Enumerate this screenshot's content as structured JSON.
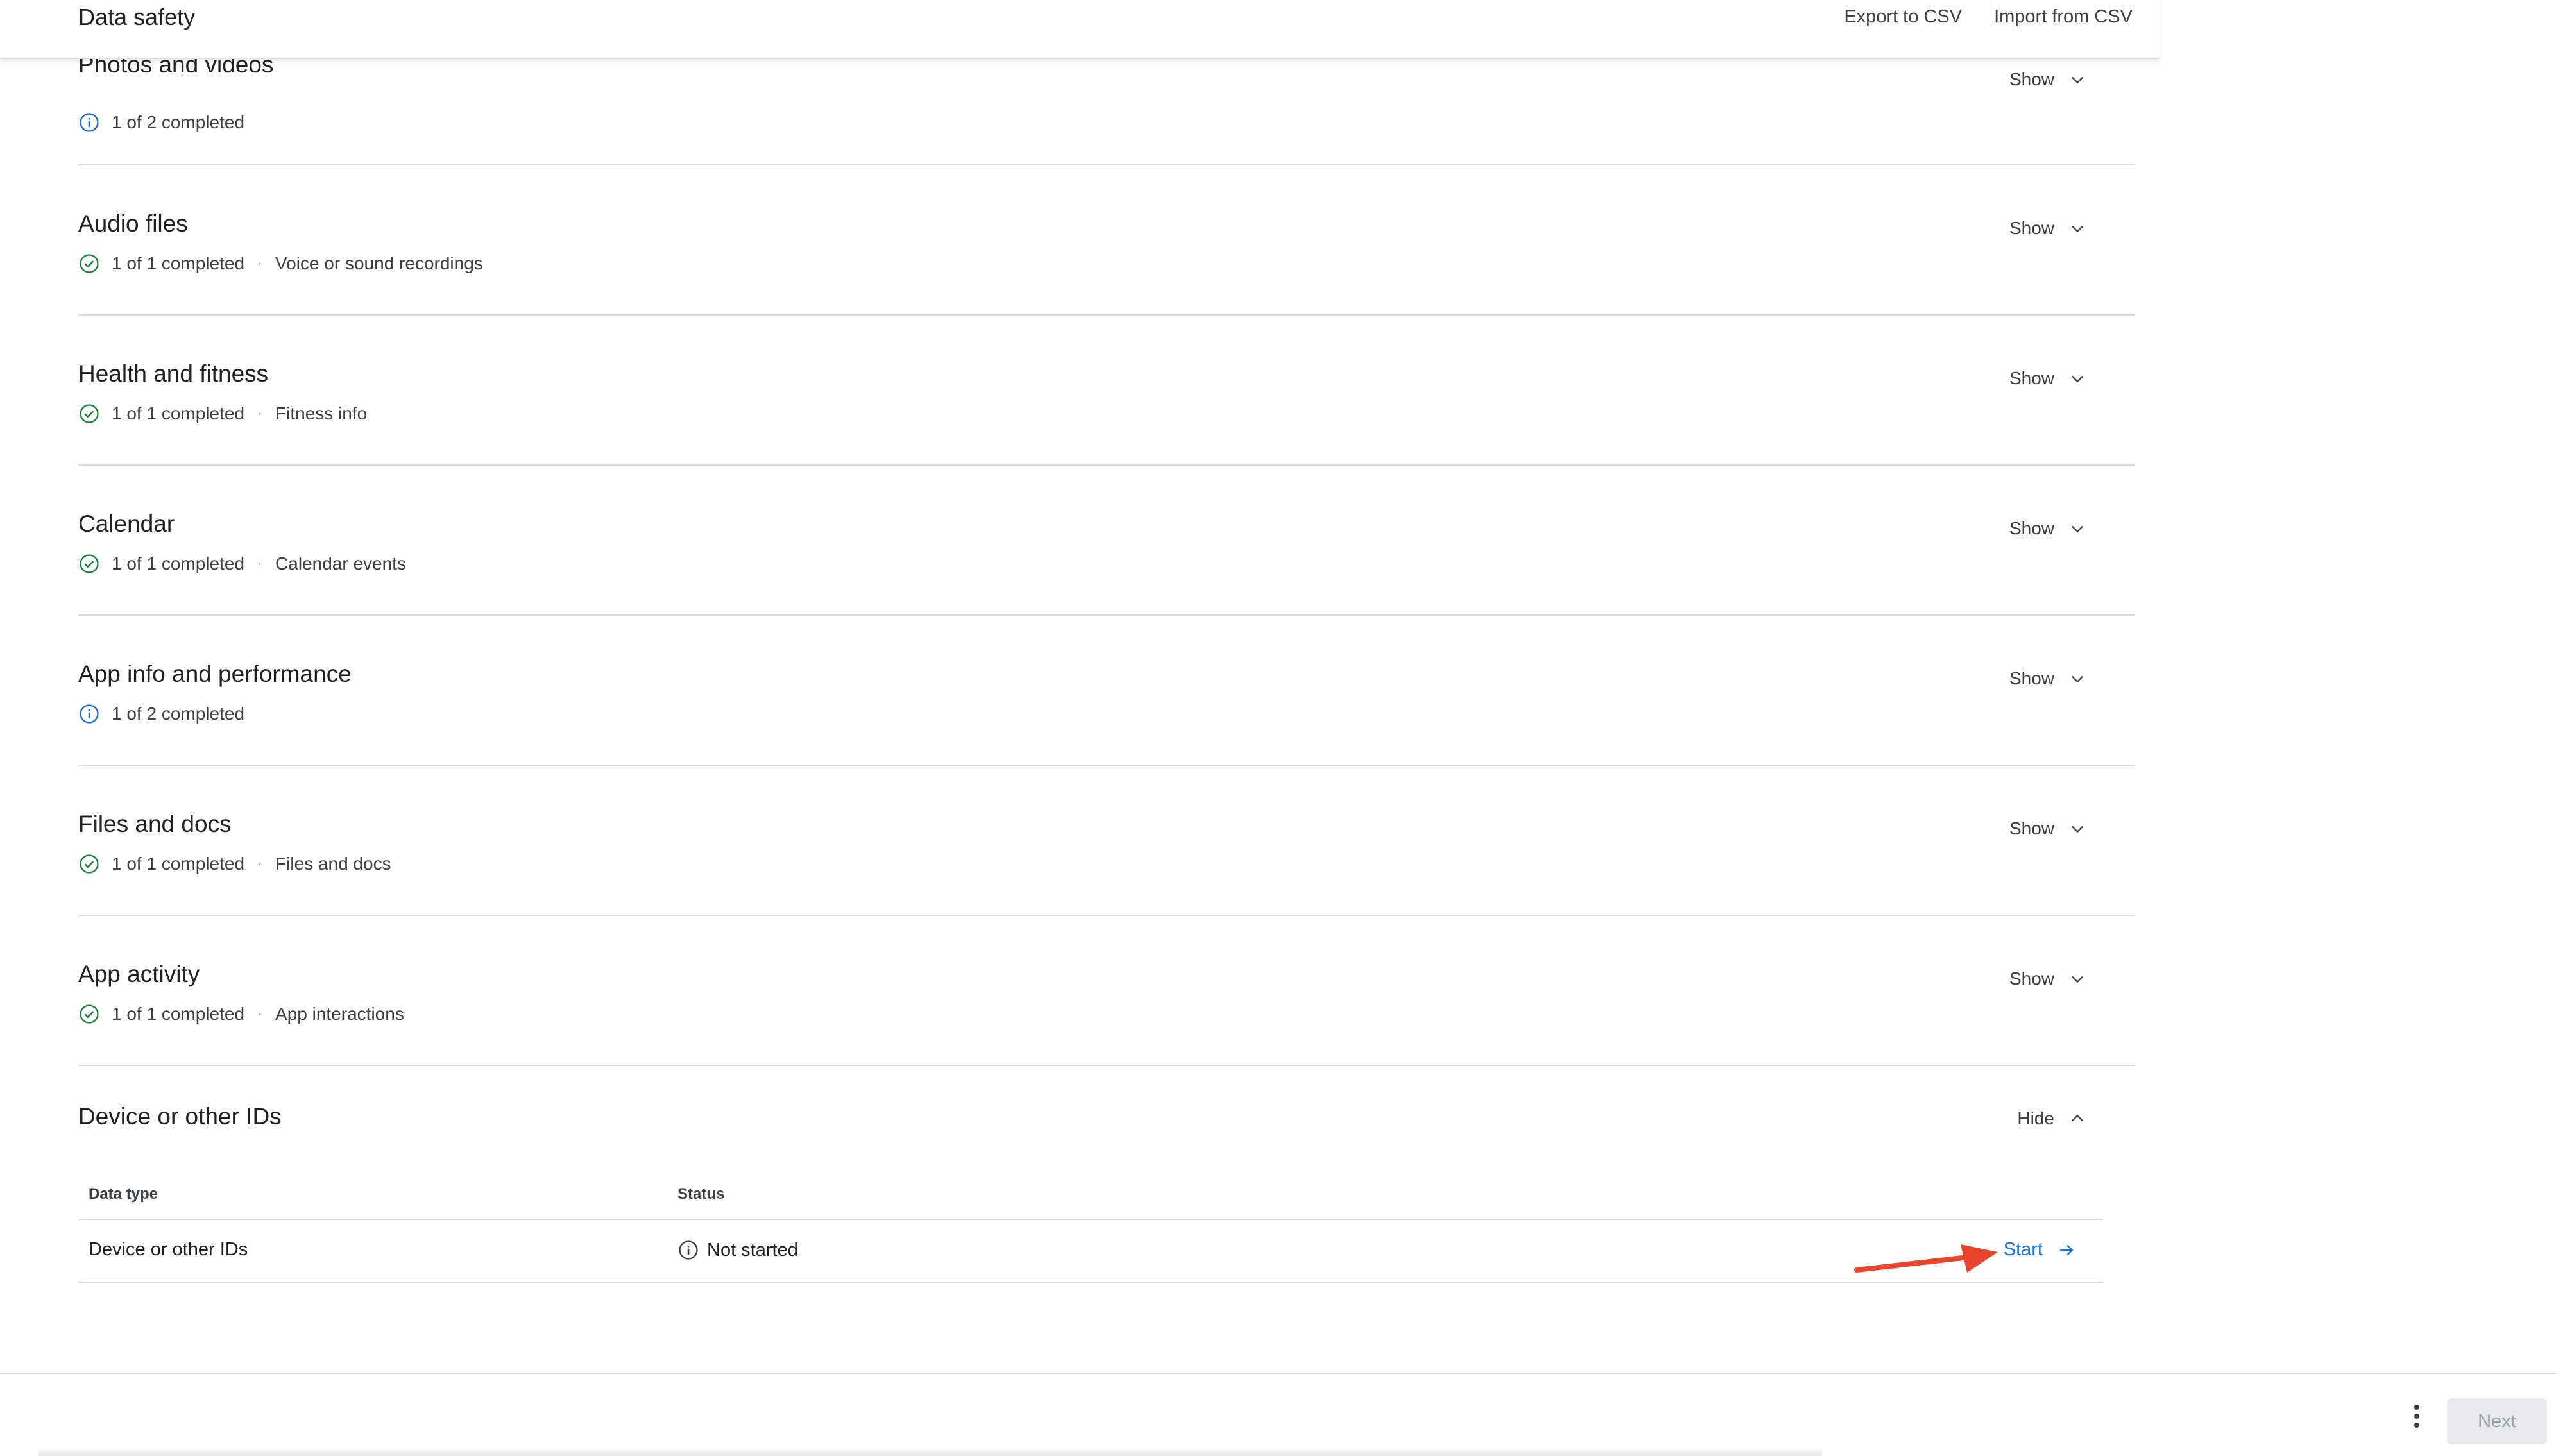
{
  "header": {
    "title": "Data safety",
    "export_label": "Export to CSV",
    "import_label": "Import from CSV"
  },
  "sections": [
    {
      "title": "Photos and videos",
      "status": "1 of 2 completed",
      "status_icon": "info-icon",
      "detail": "",
      "toggle": "Show"
    },
    {
      "title": "Audio files",
      "status": "1 of 1 completed",
      "status_icon": "check-circle-icon",
      "detail": "Voice or sound recordings",
      "toggle": "Show"
    },
    {
      "title": "Health and fitness",
      "status": "1 of 1 completed",
      "status_icon": "check-circle-icon",
      "detail": "Fitness info",
      "toggle": "Show"
    },
    {
      "title": "Calendar",
      "status": "1 of 1 completed",
      "status_icon": "check-circle-icon",
      "detail": "Calendar events",
      "toggle": "Show"
    },
    {
      "title": "App info and performance",
      "status": "1 of 2 completed",
      "status_icon": "info-icon",
      "detail": "",
      "toggle": "Show"
    },
    {
      "title": "Files and docs",
      "status": "1 of 1 completed",
      "status_icon": "check-circle-icon",
      "detail": "Files and docs",
      "toggle": "Show"
    },
    {
      "title": "App activity",
      "status": "1 of 1 completed",
      "status_icon": "check-circle-icon",
      "detail": "App interactions",
      "toggle": "Show"
    }
  ],
  "expanded": {
    "title": "Device or other IDs",
    "toggle": "Hide",
    "table": {
      "headers": [
        "Data type",
        "Status"
      ],
      "rows": [
        {
          "data_type": "Device or other IDs",
          "status": "Not started",
          "action": "Start"
        }
      ]
    }
  },
  "footer": {
    "next_label": "Next"
  },
  "colors": {
    "link": "#1a73e8",
    "success": "#188038",
    "info": "#1967d2",
    "annotation_arrow": "#e8452c"
  }
}
